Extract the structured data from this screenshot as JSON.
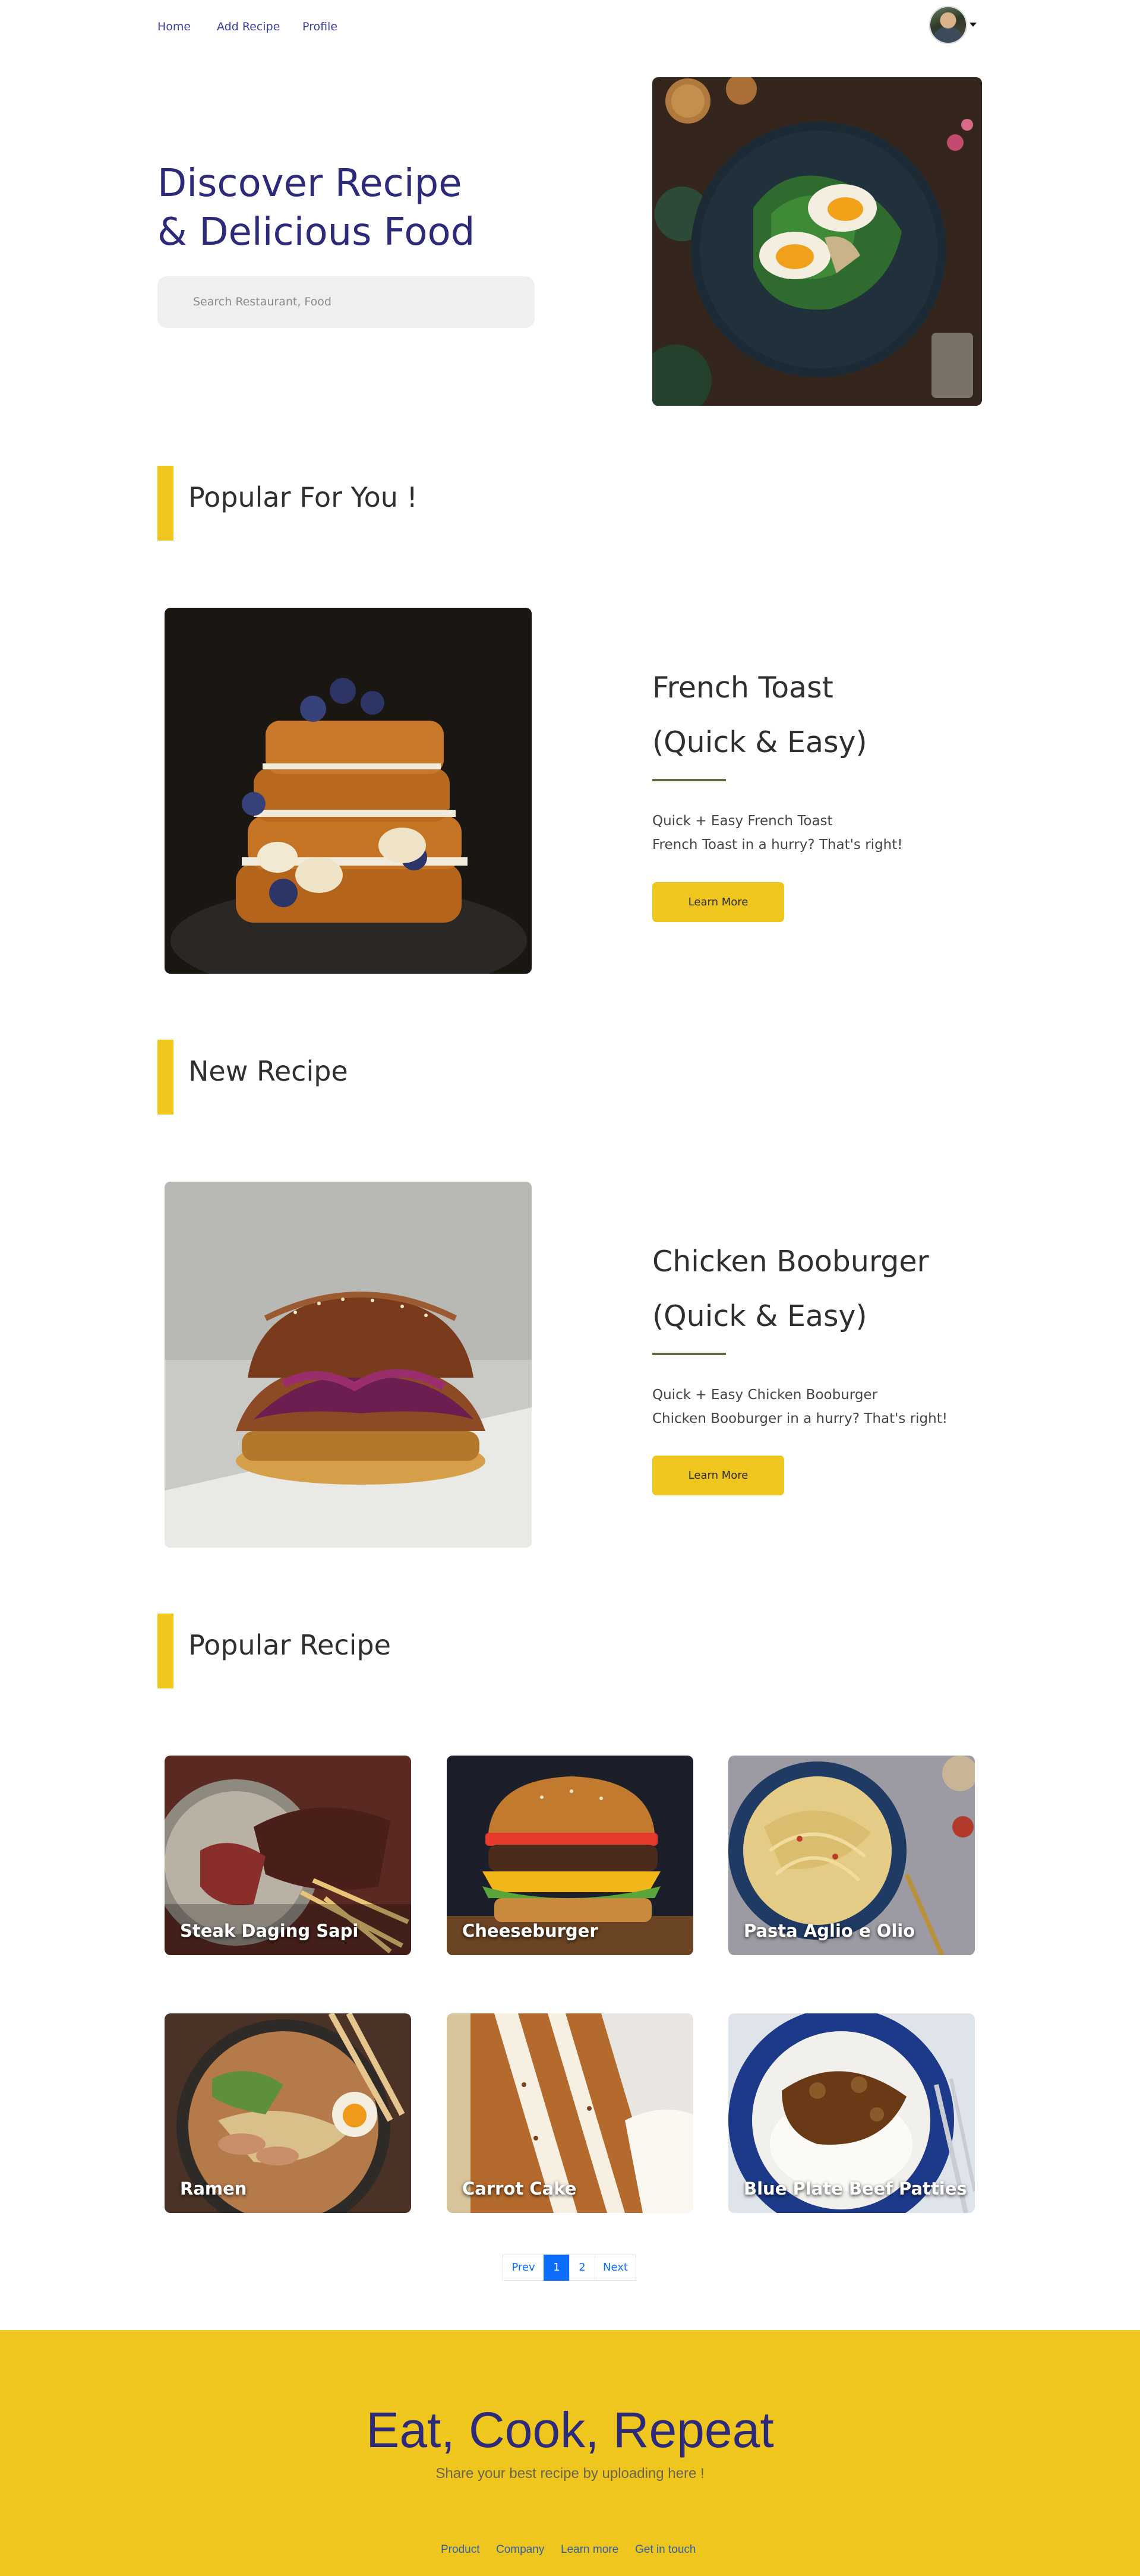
{
  "nav": {
    "home": "Home",
    "add_recipe": "Add Recipe",
    "profile": "Profile"
  },
  "hero": {
    "title_line1": "Discover Recipe",
    "title_line2": "& Delicious Food",
    "search_placeholder": "Search Restaurant, Food"
  },
  "sections": {
    "popular_for_you": "Popular For You !",
    "new_recipe": "New Recipe",
    "popular_recipe": "Popular Recipe"
  },
  "featured": [
    {
      "title_line1": "French Toast",
      "title_line2": "(Quick & Easy)",
      "desc_line1": "Quick + Easy French Toast",
      "desc_line2": "French Toast in a hurry? That's right!",
      "button": "Learn More"
    },
    {
      "title_line1": "Chicken Booburger",
      "title_line2": "(Quick & Easy)",
      "desc_line1": "Quick + Easy Chicken Booburger",
      "desc_line2": "Chicken Booburger in a hurry? That's right!",
      "button": "Learn More"
    }
  ],
  "popular_recipes": [
    {
      "name": "Steak Daging Sapi"
    },
    {
      "name": "Cheeseburger"
    },
    {
      "name": "Pasta Aglio e Olio"
    },
    {
      "name": "Ramen"
    },
    {
      "name": "Carrot Cake"
    },
    {
      "name": "Blue Plate Beef Patties"
    }
  ],
  "pagination": {
    "prev": "Prev",
    "pages": [
      "1",
      "2"
    ],
    "current": "1",
    "next": "Next"
  },
  "footer": {
    "title": "Eat, Cook, Repeat",
    "subtitle": "Share your best recipe by uploading here !",
    "links": [
      "Product",
      "Company",
      "Learn more",
      "Get in touch"
    ]
  },
  "colors": {
    "accent_yellow": "#efc61d",
    "heading_navy": "#2e2a7a",
    "link_blue": "#0d6efd"
  }
}
